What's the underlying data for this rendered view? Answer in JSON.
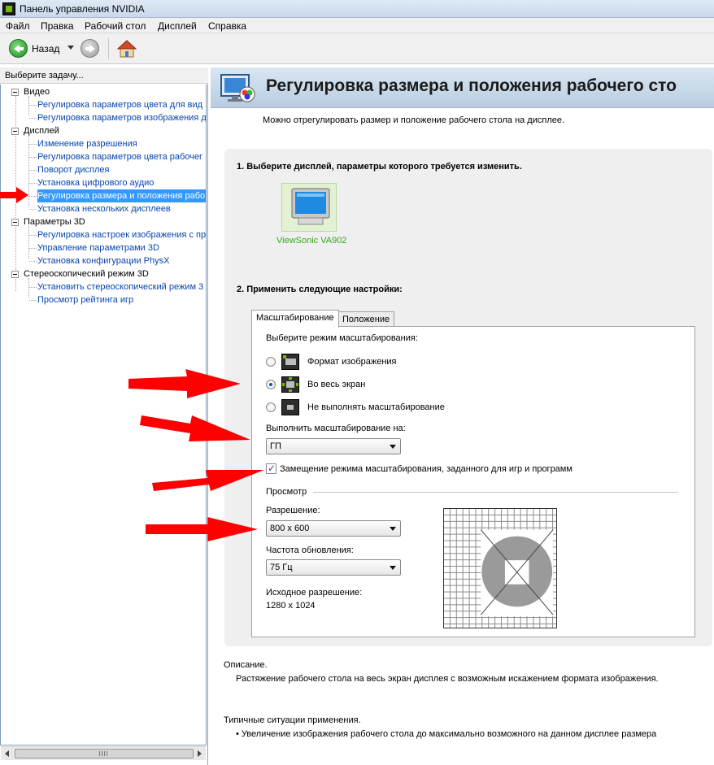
{
  "window": {
    "title": "Панель управления NVIDIA"
  },
  "menu": [
    "Файл",
    "Правка",
    "Рабочий стол",
    "Дисплей",
    "Справка"
  ],
  "toolbar": {
    "back_label": "Назад"
  },
  "left": {
    "header": "Выберите задачу...",
    "tree": [
      {
        "label": "Видео",
        "type": "category"
      },
      {
        "label": "Регулировка параметров цвета для вид",
        "type": "link"
      },
      {
        "label": "Регулировка параметров изображения д",
        "type": "link"
      },
      {
        "label": "Дисплей",
        "type": "category"
      },
      {
        "label": "Изменение разрешения",
        "type": "link"
      },
      {
        "label": "Регулировка параметров цвета рабочег",
        "type": "link"
      },
      {
        "label": "Поворот дисплея",
        "type": "link"
      },
      {
        "label": "Установка цифрового аудио",
        "type": "link"
      },
      {
        "label": "Регулировка размера и положения рабо",
        "type": "link",
        "selected": true
      },
      {
        "label": "Установка нескольких дисплеев",
        "type": "link"
      },
      {
        "label": "Параметры 3D",
        "type": "category"
      },
      {
        "label": "Регулировка настроек изображения с пр",
        "type": "link"
      },
      {
        "label": "Управление параметрами 3D",
        "type": "link"
      },
      {
        "label": "Установка конфигурации PhysX",
        "type": "link"
      },
      {
        "label": "Стереоскопический режим 3D",
        "type": "category"
      },
      {
        "label": "Установить стереоскопический режим 3",
        "type": "link"
      },
      {
        "label": "Просмотр рейтинга игр",
        "type": "link"
      }
    ]
  },
  "main": {
    "title": "Регулировка размера и положения рабочего сто",
    "intro": "Можно отрегулировать размер и положение рабочего стола на дисплее.",
    "step1": "1. Выберите дисплей, параметры которого требуется изменить.",
    "display_name": "ViewSonic VA902",
    "step2": "2. Применить следующие настройки:",
    "tabs": [
      {
        "label": "Масштабирование",
        "active": true
      },
      {
        "label": "Положение",
        "active": false
      }
    ],
    "scaling": {
      "mode_label": "Выберите режим масштабирования:",
      "options": [
        {
          "label": "Формат изображения",
          "checked": false
        },
        {
          "label": "Во весь экран",
          "checked": true
        },
        {
          "label": "Не выполнять масштабирование",
          "checked": false
        }
      ],
      "perform_on_label": "Выполнить масштабирование на:",
      "perform_on_value": "ГП",
      "override_label": "Замещение режима масштабирования, заданного для игр и программ",
      "override_checked": true,
      "preview_label": "Просмотр",
      "resolution_label": "Разрешение:",
      "resolution_value": "800 x 600",
      "refresh_label": "Частота обновления:",
      "refresh_value": "75 Гц",
      "native_label": "Исходное разрешение:",
      "native_value": "1280 x 1024"
    },
    "description_head": "Описание.",
    "description_text": "Растяжение рабочего стола на весь экран дисплея с возможным искажением формата изображения.",
    "usage_head": "Типичные ситуации применения.",
    "usage_item": "• Увеличение изображения рабочего стола до максимально возможного на данном дисплее размера"
  },
  "colors": {
    "nvidia_green": "#76b900",
    "link_blue": "#0645ad",
    "selection": "#3399ff",
    "arrow_red": "#ff0000"
  }
}
